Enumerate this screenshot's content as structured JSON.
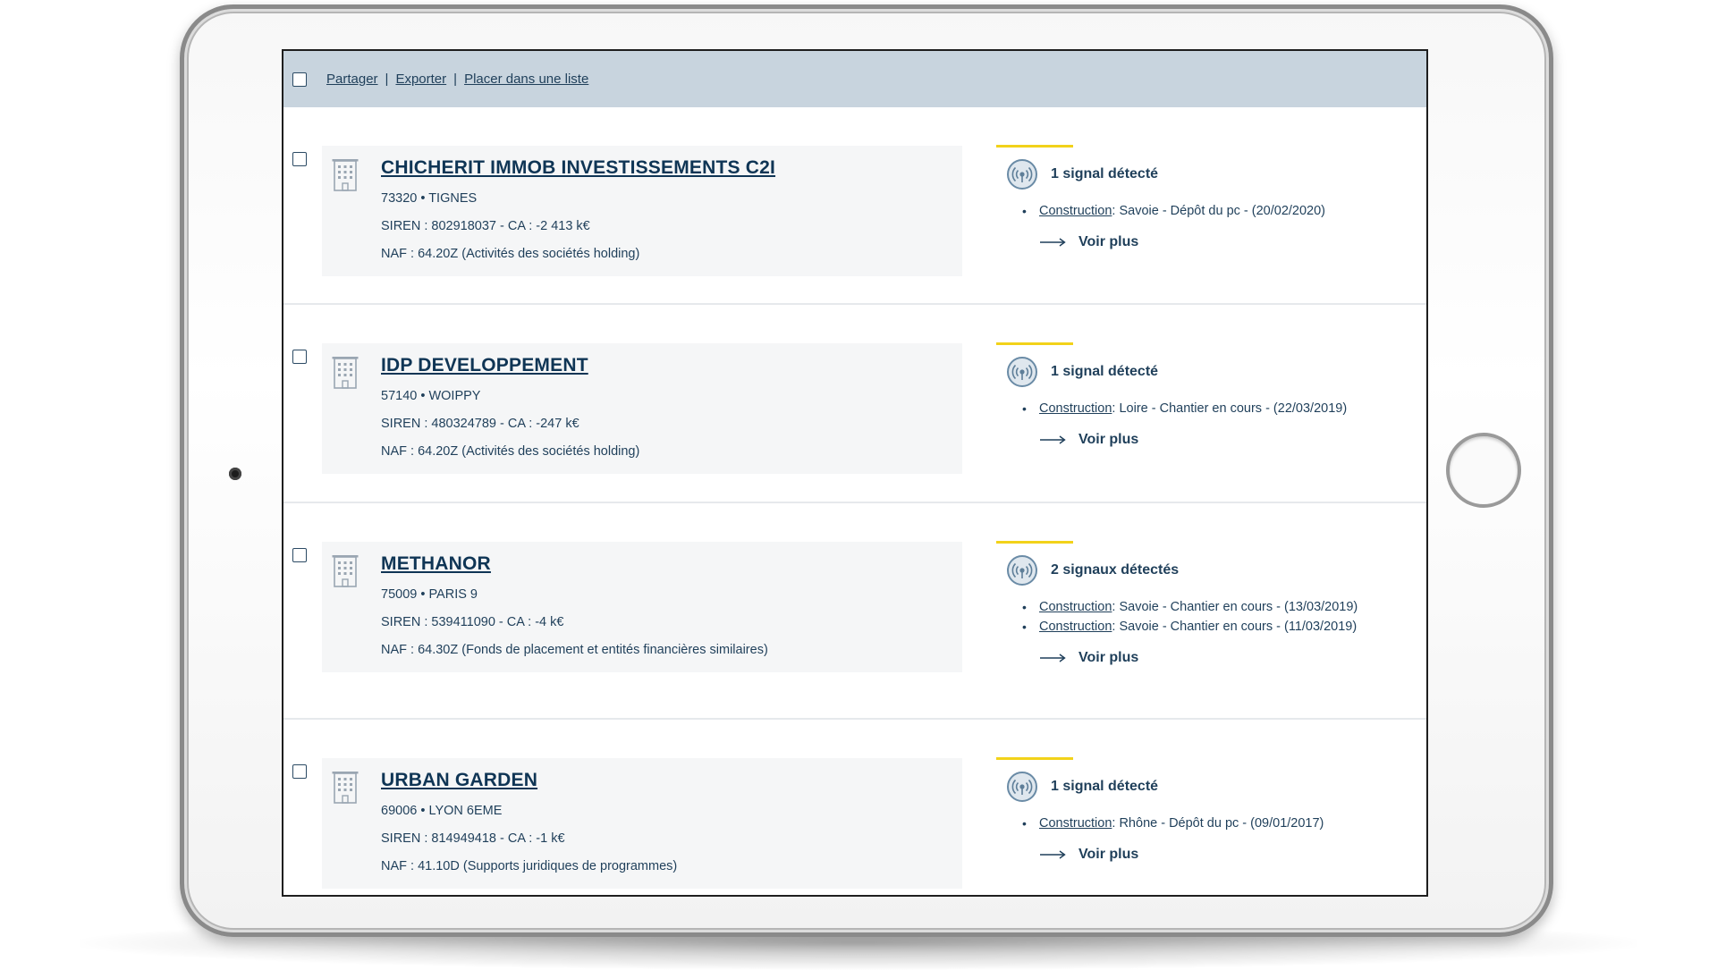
{
  "toolbar": {
    "share_label": "Partager",
    "separator": "|",
    "export_label": "Exporter",
    "list_label": "Placer dans une liste"
  },
  "results": [
    {
      "name": "CHICHERIT IMMOB INVESTISSEMENTS C2I",
      "location": "73320 • TIGNES",
      "siren": "SIREN : 802918037 - CA : -2 413 k€",
      "naf": "NAF : 64.20Z (Activités des sociétés holding)",
      "signal_title": "1 signal détecté",
      "signals": [
        {
          "category": "Construction",
          "detail": ": Savoie  - Dépôt du pc - (20/02/2020)"
        }
      ],
      "more_label": "Voir plus"
    },
    {
      "name": "IDP DEVELOPPEMENT",
      "location": "57140 • WOIPPY",
      "siren": "SIREN : 480324789 - CA : -247 k€",
      "naf": "NAF : 64.20Z (Activités des sociétés holding)",
      "signal_title": "1 signal détecté",
      "signals": [
        {
          "category": "Construction",
          "detail": ": Loire  - Chantier en cours - (22/03/2019)"
        }
      ],
      "more_label": "Voir plus"
    },
    {
      "name": "METHANOR",
      "location": "75009 • PARIS 9",
      "siren": "SIREN : 539411090 - CA : -4 k€",
      "naf": "NAF : 64.30Z (Fonds de placement et entités financières similaires)",
      "signal_title": "2 signaux détectés",
      "signals": [
        {
          "category": "Construction",
          "detail": ": Savoie  - Chantier en cours - (13/03/2019)"
        },
        {
          "category": "Construction",
          "detail": ": Savoie  - Chantier en cours - (11/03/2019)"
        }
      ],
      "more_label": "Voir plus"
    },
    {
      "name": "URBAN GARDEN",
      "location": "69006 • LYON 6EME",
      "siren": "SIREN : 814949418 - CA : -1 k€",
      "naf": "NAF : 41.10D (Supports juridiques de programmes)",
      "signal_title": "1 signal détecté",
      "signals": [
        {
          "category": "Construction",
          "detail": ": Rhône  - Dépôt du pc - (09/01/2017)"
        }
      ],
      "more_label": "Voir plus"
    }
  ],
  "colors": {
    "toolbar_bg": "#c8d4de",
    "text": "#1f3f5a",
    "company_name": "#0f3555",
    "card_bg": "#f5f6f7",
    "accent_yellow": "#f2d21a"
  },
  "icons": [
    "building-icon",
    "signal-antenna-icon",
    "arrow-right-icon"
  ]
}
